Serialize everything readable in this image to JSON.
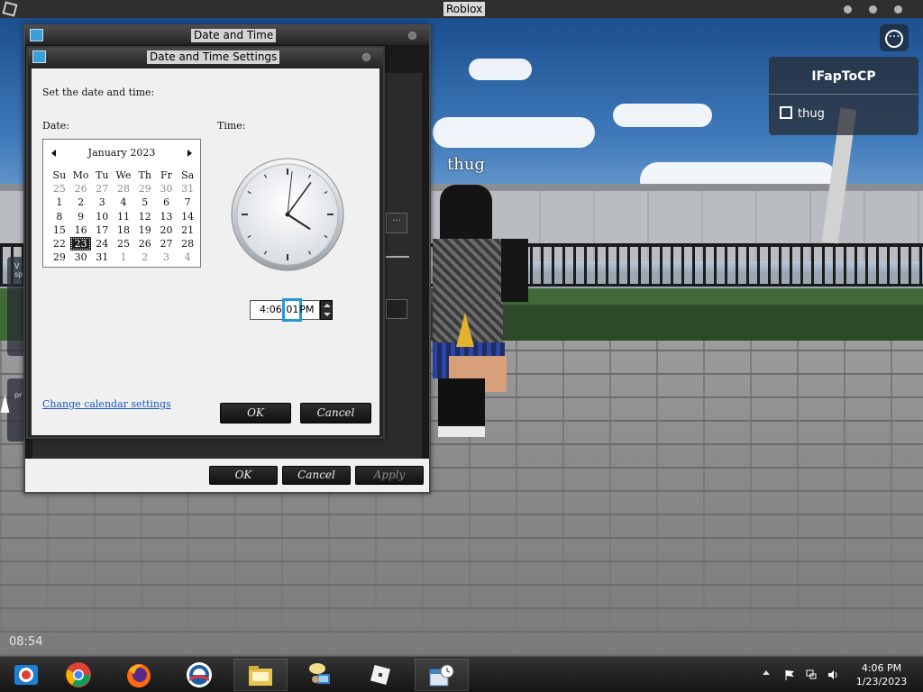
{
  "roblox": {
    "window_title": "Roblox",
    "player_list": {
      "local_player": "IFapToCP",
      "other_player": "thug"
    },
    "nametag": "thug",
    "timer": "08:54",
    "side_fragments": [
      "V",
      "sp",
      "pr"
    ]
  },
  "outer_dialog": {
    "title": "Date and Time",
    "buttons": {
      "ok": "OK",
      "cancel": "Cancel",
      "apply": "Apply"
    },
    "fragment_button": "..."
  },
  "settings_dialog": {
    "title": "Date and Time Settings",
    "instruction": "Set the date and time:",
    "date_label": "Date:",
    "time_label": "Time:",
    "calendar": {
      "month": "January 2023",
      "weekdays": [
        "Su",
        "Mo",
        "Tu",
        "We",
        "Th",
        "Fr",
        "Sa"
      ],
      "weeks": [
        [
          "25",
          "26",
          "27",
          "28",
          "29",
          "30",
          "31"
        ],
        [
          "1",
          "2",
          "3",
          "4",
          "5",
          "6",
          "7"
        ],
        [
          "8",
          "9",
          "10",
          "11",
          "12",
          "13",
          "14"
        ],
        [
          "15",
          "16",
          "17",
          "18",
          "19",
          "20",
          "21"
        ],
        [
          "22",
          "23",
          "24",
          "25",
          "26",
          "27",
          "28"
        ],
        [
          "29",
          "30",
          "31",
          "1",
          "2",
          "3",
          "4"
        ]
      ],
      "selected_day": "23"
    },
    "time": {
      "hours_minutes": "4:06",
      "separator": ":",
      "seconds": "01",
      "ampm": "PM"
    },
    "clock": {
      "hour": 4,
      "minute": 6,
      "second": 1
    },
    "change_link": "Change calendar settings",
    "buttons": {
      "ok": "OK",
      "cancel": "Cancel"
    }
  },
  "taskbar": {
    "apps": [
      "chromium-icon",
      "chrome-icon",
      "firefox-icon",
      "obama-icon",
      "file-explorer-icon",
      "network-user-icon",
      "roblox-icon",
      "date-time-icon"
    ],
    "clock_time": "4:06 PM",
    "clock_date": "1/23/2023"
  }
}
